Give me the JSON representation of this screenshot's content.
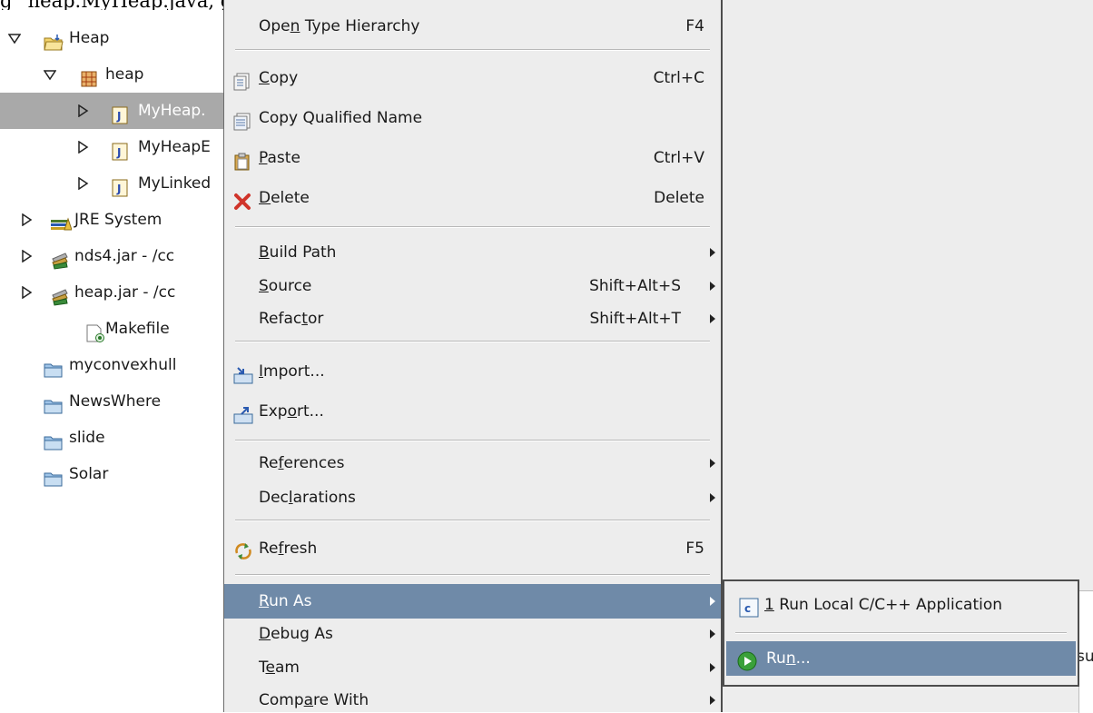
{
  "top_partial_text": "g_ heap.MyHeap.java, g",
  "tree": {
    "items": [
      {
        "name": "project-heap",
        "label": "Heap",
        "twisty": "down",
        "icon": "folder-project-icon",
        "indent": 0
      },
      {
        "name": "package-heap",
        "label": "heap",
        "twisty": "down",
        "icon": "package-icon",
        "indent": 1
      },
      {
        "name": "file-myheap",
        "label": "MyHeap.",
        "twisty": "right",
        "icon": "java-file-icon",
        "indent": 2,
        "selected": true
      },
      {
        "name": "file-myheapb",
        "label": "MyHeapE",
        "twisty": "right",
        "icon": "java-file-icon",
        "indent": 2
      },
      {
        "name": "file-mylinked",
        "label": "MyLinked",
        "twisty": "right",
        "icon": "java-file-icon",
        "indent": 2
      },
      {
        "name": "jre-system-library",
        "label": "JRE System",
        "twisty": "right",
        "icon": "library-icon",
        "indent": 1
      },
      {
        "name": "jar-nds4",
        "label": "nds4.jar - /cc",
        "twisty": "right",
        "icon": "jar-icon",
        "indent": 1
      },
      {
        "name": "jar-heap",
        "label": "heap.jar - /cc",
        "twisty": "right",
        "icon": "jar-icon",
        "indent": 1
      },
      {
        "name": "file-makefile",
        "label": "Makefile",
        "twisty": "none",
        "icon": "makefile-icon",
        "indent": 2
      },
      {
        "name": "project-myconvexhull",
        "label": "myconvexhull",
        "twisty": "none",
        "icon": "folder-icon",
        "indent": 0
      },
      {
        "name": "project-newswhere",
        "label": "NewsWhere",
        "twisty": "none",
        "icon": "folder-icon",
        "indent": 0
      },
      {
        "name": "project-slide",
        "label": "slide",
        "twisty": "none",
        "icon": "folder-icon",
        "indent": 0
      },
      {
        "name": "project-solar",
        "label": "Solar",
        "twisty": "none",
        "icon": "folder-icon",
        "indent": 0
      }
    ]
  },
  "menu": {
    "open_type_hierarchy": {
      "pre": "Ope",
      "u": "n",
      "post": " Type Hierarchy",
      "shortcut": "F4"
    },
    "copy": {
      "pre": "",
      "u": "C",
      "post": "opy",
      "shortcut": "Ctrl+C"
    },
    "copy_qualified": {
      "label": "Copy Qualified Name"
    },
    "paste": {
      "pre": "",
      "u": "P",
      "post": "aste",
      "shortcut": "Ctrl+V"
    },
    "delete": {
      "pre": "",
      "u": "D",
      "post": "elete",
      "shortcut": "Delete"
    },
    "build_path": {
      "pre": "",
      "u": "B",
      "post": "uild Path"
    },
    "source": {
      "pre": "",
      "u": "S",
      "post": "ource",
      "shortcut": "Shift+Alt+S"
    },
    "refactor": {
      "pre": "Refac",
      "u": "t",
      "post": "or",
      "shortcut": "Shift+Alt+T"
    },
    "import": {
      "pre": "",
      "u": "I",
      "post": "mport..."
    },
    "export": {
      "pre": "Exp",
      "u": "o",
      "post": "rt..."
    },
    "references": {
      "pre": "Re",
      "u": "f",
      "post": "erences"
    },
    "declarations": {
      "pre": "Dec",
      "u": "l",
      "post": "arations"
    },
    "refresh": {
      "pre": "Re",
      "u": "f",
      "post": "resh",
      "shortcut": "F5"
    },
    "run_as": {
      "pre": "",
      "u": "R",
      "post": "un As"
    },
    "debug_as": {
      "pre": "",
      "u": "D",
      "post": "ebug As"
    },
    "team": {
      "pre": "T",
      "u": "e",
      "post": "am"
    },
    "compare_with": {
      "pre": "Comp",
      "u": "a",
      "post": "re With"
    }
  },
  "submenu": {
    "run_local": {
      "pre": "",
      "u": "1",
      "post": " Run Local C/C++ Application"
    },
    "run": {
      "pre": "Ru",
      "u": "n",
      "post": "..."
    }
  },
  "edge_text": "su",
  "colors": {
    "highlight": "#6f8aa8",
    "selection": "#a9a9a9",
    "menu_bg": "#ededed"
  }
}
